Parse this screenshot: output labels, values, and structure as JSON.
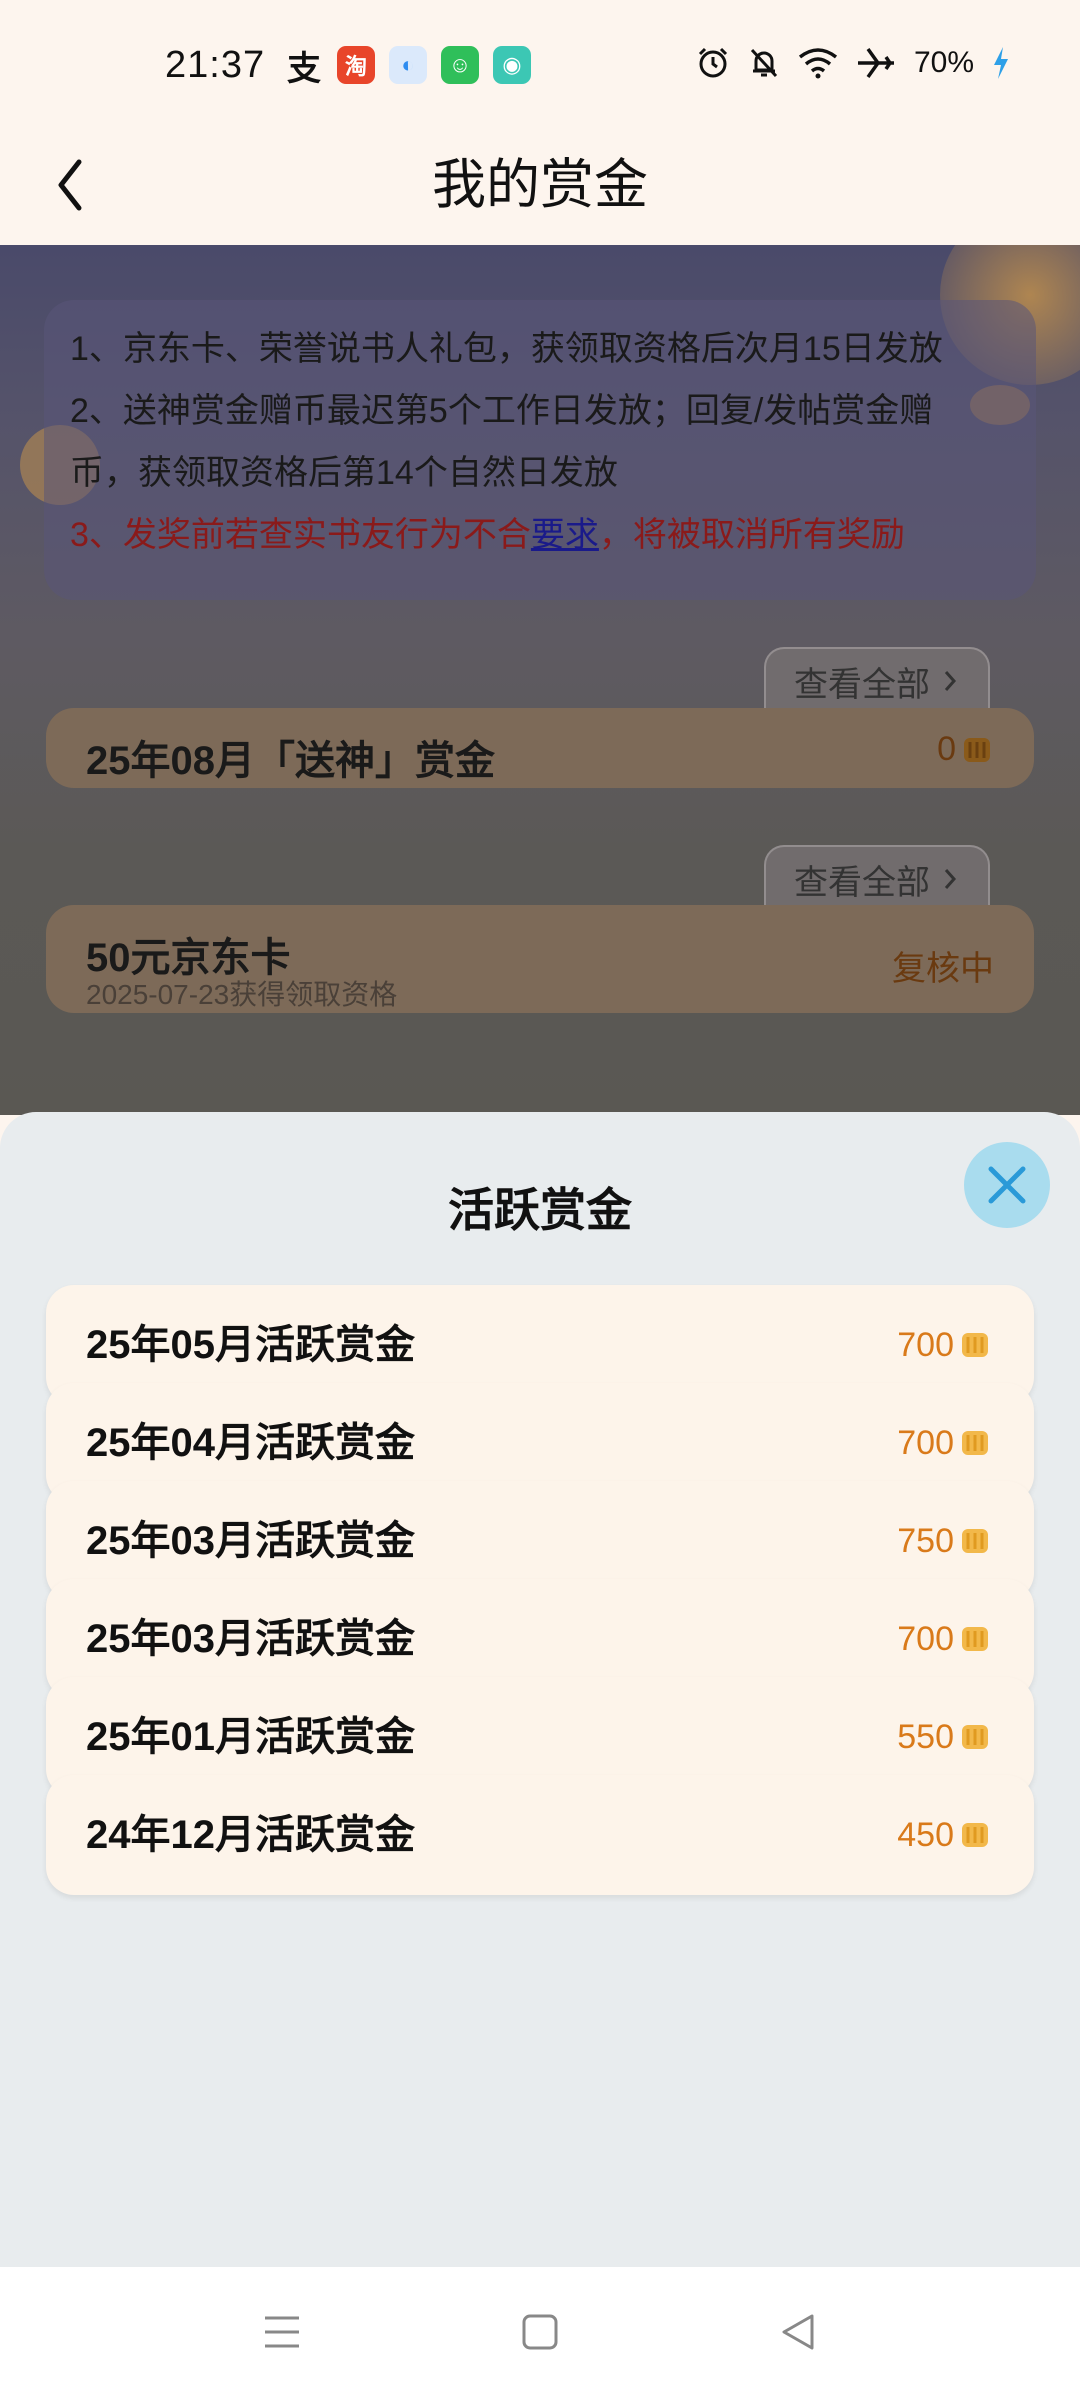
{
  "status_bar": {
    "time": "21:37",
    "battery": "70%",
    "apps": [
      {
        "icon": "alipay-icon",
        "glyph": "支",
        "color": "#111111"
      },
      {
        "icon": "taobao-icon",
        "glyph": "淘",
        "color": "#e8452a"
      },
      {
        "icon": "browser-icon",
        "glyph": "◐",
        "color": "#2e8cf0"
      },
      {
        "icon": "bag-app-icon",
        "glyph": "☺",
        "color": "#2fbf5a"
      },
      {
        "icon": "chat-app-icon",
        "glyph": "◉",
        "color": "#3cc7b4"
      }
    ]
  },
  "header": {
    "title": "我的赏金"
  },
  "notice": {
    "line1": "1、京东卡、荣誉说书人礼包，获领取资格后次月15日发放",
    "line2a": "2、送神赏金赠币最迟第5个工作日发放；回复/发帖赏金赠",
    "line2b": "币，获领取资格后第14个自然日发放",
    "line3_pre": "3、发奖前若查实书友行为不合",
    "line3_link": "要求",
    "line3_post": "，将被取消所有奖励"
  },
  "sections": {
    "view_all_label": "查看全部",
    "farewell": {
      "title": "25年08月「送神」赏金",
      "value": "0"
    },
    "jd_card": {
      "title": "50元京东卡",
      "sub": "2025-07-23获得领取资格",
      "status": "复核中"
    }
  },
  "sheet": {
    "title": "活跃赏金",
    "rows": [
      {
        "label": "25年05月活跃赏金",
        "amount": "700"
      },
      {
        "label": "25年04月活跃赏金",
        "amount": "700"
      },
      {
        "label": "25年03月活跃赏金",
        "amount": "750"
      },
      {
        "label": "25年03月活跃赏金",
        "amount": "700"
      },
      {
        "label": "25年01月活跃赏金",
        "amount": "550"
      },
      {
        "label": "24年12月活跃赏金",
        "amount": "450"
      }
    ]
  },
  "colors": {
    "accent_orange": "#d97a1a",
    "close_button": "#a9dcee",
    "notice_red": "#8a1a1a"
  }
}
